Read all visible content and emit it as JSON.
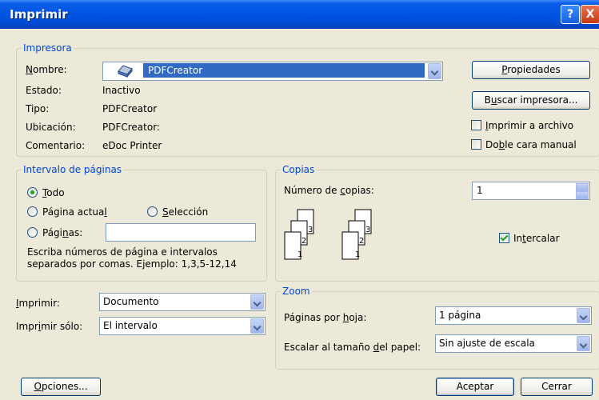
{
  "title": "Imprimir",
  "title_buttons": {
    "help": "?",
    "close": "X"
  },
  "printer": {
    "legend": "Impresora",
    "name_label": "Nombre:",
    "name_value": "PDFCreator",
    "state_label": "Estado:",
    "state_value": "Inactivo",
    "type_label": "Tipo:",
    "type_value": "PDFCreator",
    "location_label": "Ubicación:",
    "location_value": "PDFCreator:",
    "comment_label": "Comentario:",
    "comment_value": "eDoc Printer",
    "properties_button": "Propiedades",
    "find_printer_button": "Buscar impresora...",
    "print_to_file": "Imprimir a archivo",
    "manual_duplex": "Doble cara manual"
  },
  "page_range": {
    "legend": "Intervalo de páginas",
    "all": "Todo",
    "current_page": "Página actual",
    "selection": "Selección",
    "pages": "Páginas:",
    "pages_value": "",
    "hint_line1": "Escriba números de página e intervalos",
    "hint_line2": "separados por comas. Ejemplo: 1,3,5-12,14"
  },
  "copies": {
    "legend": "Copias",
    "number_label": "Número de copias:",
    "number_value": "1",
    "collate": "Intercalar",
    "icon_pages": [
      "3",
      "2",
      "1"
    ]
  },
  "print_what": {
    "label": "Imprimir:",
    "value": "Documento"
  },
  "print_only": {
    "label": "Imprimir sólo:",
    "value": "El intervalo"
  },
  "zoom": {
    "legend": "Zoom",
    "pages_per_sheet_label": "Páginas por hoja:",
    "pages_per_sheet_value": "1 página",
    "scale_label": "Escalar al tamaño del papel:",
    "scale_value": "Sin ajuste de escala"
  },
  "footer": {
    "options_button": "Opciones...",
    "ok_button": "Aceptar",
    "cancel_button": "Cerrar"
  },
  "colors": {
    "titlebar": "#0054e3",
    "legend_text": "#0046d5",
    "dialog_bg": "#ece9d8",
    "selection": "#316ac5"
  }
}
